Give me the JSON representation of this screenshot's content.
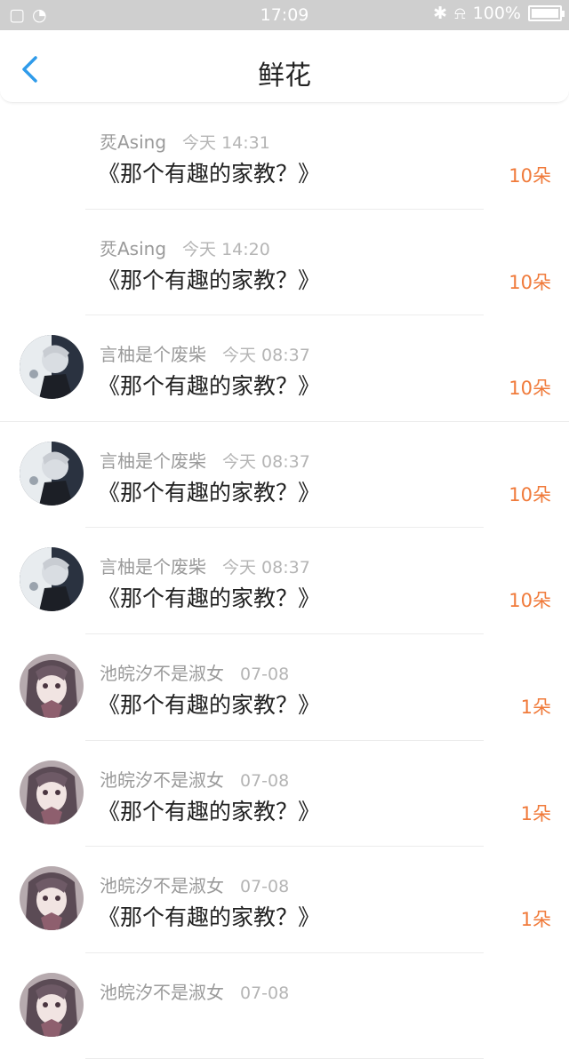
{
  "status_bar": {
    "time": "17:09",
    "battery": "100%"
  },
  "header": {
    "title": "鲜花"
  },
  "rows": [
    {
      "name": "烎Asing",
      "time": "今天 14:31",
      "book": "《那个有趣的家教？》",
      "count": "10朵",
      "avatar": "none"
    },
    {
      "name": "烎Asing",
      "time": "今天 14:20",
      "book": "《那个有趣的家教？》",
      "count": "10朵",
      "avatar": "none"
    },
    {
      "name": "言柚是个废柴",
      "time": "今天 08:37",
      "book": "《那个有趣的家教？》",
      "count": "10朵",
      "avatar": "dark"
    },
    {
      "name": "言柚是个废柴",
      "time": "今天 08:37",
      "book": "《那个有趣的家教？》",
      "count": "10朵",
      "avatar": "dark"
    },
    {
      "name": "言柚是个废柴",
      "time": "今天 08:37",
      "book": "《那个有趣的家教？》",
      "count": "10朵",
      "avatar": "dark"
    },
    {
      "name": "池皖汐不是淑女",
      "time": "07-08",
      "book": "《那个有趣的家教？》",
      "count": "1朵",
      "avatar": "anime"
    },
    {
      "name": "池皖汐不是淑女",
      "time": "07-08",
      "book": "《那个有趣的家教？》",
      "count": "1朵",
      "avatar": "anime"
    },
    {
      "name": "池皖汐不是淑女",
      "time": "07-08",
      "book": "《那个有趣的家教？》",
      "count": "1朵",
      "avatar": "anime"
    },
    {
      "name": "池皖汐不是淑女",
      "time": "07-08",
      "book": "",
      "count": "",
      "avatar": "anime"
    }
  ],
  "colors": {
    "accent": "#f07a3a",
    "back": "#2f9bea"
  }
}
